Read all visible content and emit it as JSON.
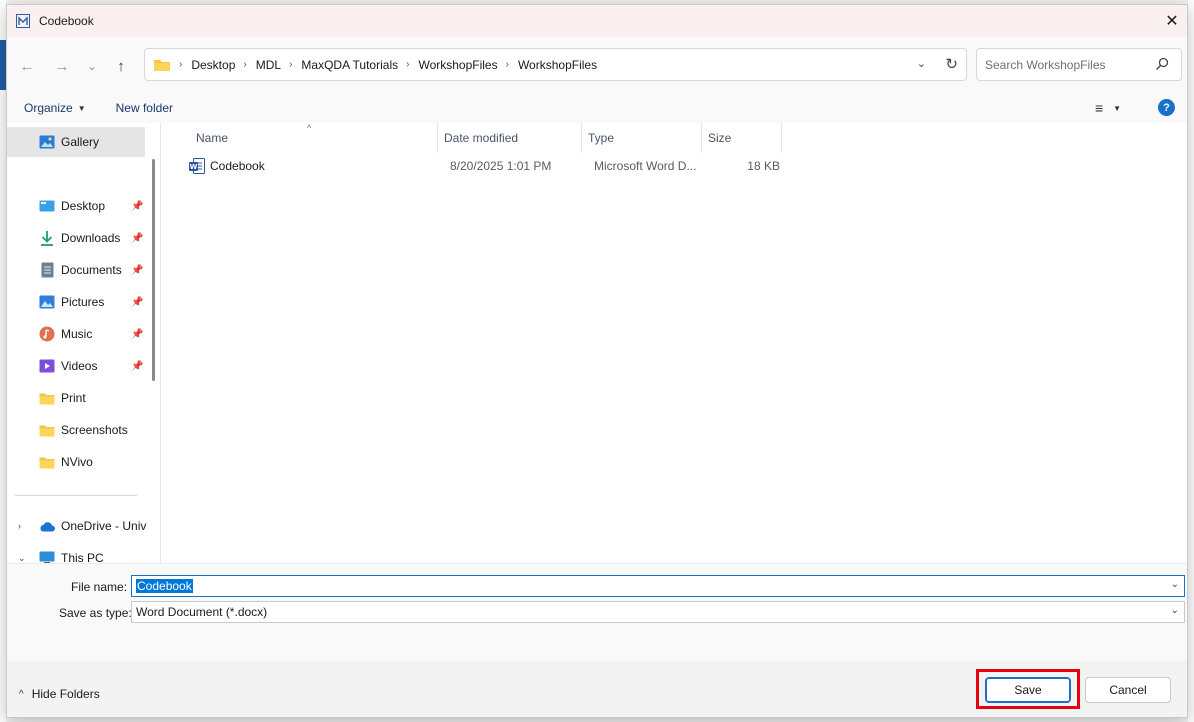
{
  "window": {
    "title": "Codebook",
    "close_glyph": "✕"
  },
  "nav": {
    "back_glyph": "←",
    "forward_glyph": "→",
    "recent_glyph": "⌄",
    "up_glyph": "↑"
  },
  "address": {
    "crumbs": [
      "Desktop",
      "MDL",
      "MaxQDA Tutorials",
      "WorkshopFiles",
      "WorkshopFiles"
    ],
    "separator": "›",
    "dropdown_glyph": "⌄",
    "refresh_glyph": "↻"
  },
  "search": {
    "placeholder": "Search WorkshopFiles"
  },
  "toolbar": {
    "organize_label": "Organize",
    "new_folder_label": "New folder",
    "view_glyph": "≡",
    "help_glyph": "?"
  },
  "sidebar": {
    "items": [
      {
        "label": "Gallery",
        "icon": "gallery-icon"
      },
      {
        "label": "Desktop",
        "icon": "desktop-icon"
      },
      {
        "label": "Downloads",
        "icon": "downloads-icon"
      },
      {
        "label": "Documents",
        "icon": "documents-icon"
      },
      {
        "label": "Pictures",
        "icon": "pictures-icon"
      },
      {
        "label": "Music",
        "icon": "music-icon"
      },
      {
        "label": "Videos",
        "icon": "videos-icon"
      },
      {
        "label": "Print",
        "icon": "folder-icon"
      },
      {
        "label": "Screenshots",
        "icon": "folder-icon"
      },
      {
        "label": "NVivo",
        "icon": "folder-icon"
      },
      {
        "label": "OneDrive - Univ",
        "icon": "onedrive-icon"
      },
      {
        "label": "This PC",
        "icon": "pc-icon"
      }
    ],
    "expand_collapsed_glyph": "›",
    "expand_open_glyph": "⌄"
  },
  "columns": {
    "name": "Name",
    "date_modified": "Date modified",
    "type": "Type",
    "size": "Size"
  },
  "files": [
    {
      "name": "Codebook",
      "date_modified": "8/20/2025 1:01 PM",
      "type": "Microsoft Word D...",
      "size": "18 KB",
      "icon": "word-doc-icon"
    }
  ],
  "form": {
    "file_name_label": "File name:",
    "file_name_value": "Codebook",
    "save_as_type_label": "Save as type:",
    "save_as_type_value": "Word Document (*.docx)"
  },
  "footer": {
    "hide_folders_label": "Hide Folders",
    "save_label": "Save",
    "cancel_label": "Cancel"
  },
  "colors": {
    "accent": "#1a6fc9",
    "highlight": "#e3000f",
    "selection": "#0078d7"
  }
}
